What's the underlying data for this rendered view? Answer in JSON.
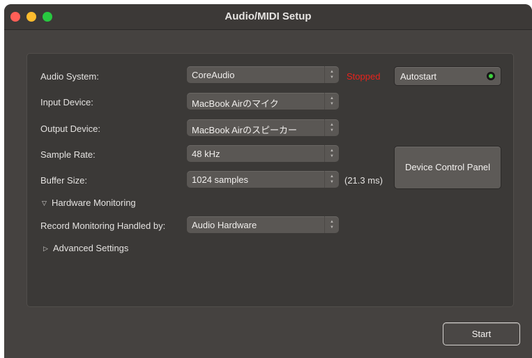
{
  "window": {
    "title": "Audio/MIDI Setup"
  },
  "settings": {
    "audio_system": {
      "label": "Audio System:",
      "value": "CoreAudio",
      "status": "Stopped"
    },
    "input_device": {
      "label": "Input Device:",
      "value": "MacBook Airのマイク"
    },
    "output_device": {
      "label": "Output Device:",
      "value": "MacBook Airのスピーカー"
    },
    "sample_rate": {
      "label": "Sample Rate:",
      "value": "48 kHz"
    },
    "buffer_size": {
      "label": "Buffer Size:",
      "value": "1024 samples",
      "latency": "(21.3 ms)"
    },
    "hardware_monitoring": {
      "label": "Hardware Monitoring",
      "expanded": true
    },
    "record_monitoring": {
      "label": "Record Monitoring Handled by:",
      "value": "Audio Hardware"
    },
    "advanced_settings": {
      "label": "Advanced Settings",
      "expanded": false
    }
  },
  "buttons": {
    "autostart": {
      "label": "Autostart",
      "led_color": "#3ed33e"
    },
    "device_control_panel": "Device Control Panel",
    "start": "Start"
  },
  "icons": {
    "chevron": "⌃⌄",
    "disclosure_open": "▽",
    "disclosure_closed": "▷"
  },
  "colors": {
    "status_stopped": "#e8231c",
    "close": "#ff5f57",
    "minimize": "#febc2e",
    "maximize": "#28c840"
  }
}
